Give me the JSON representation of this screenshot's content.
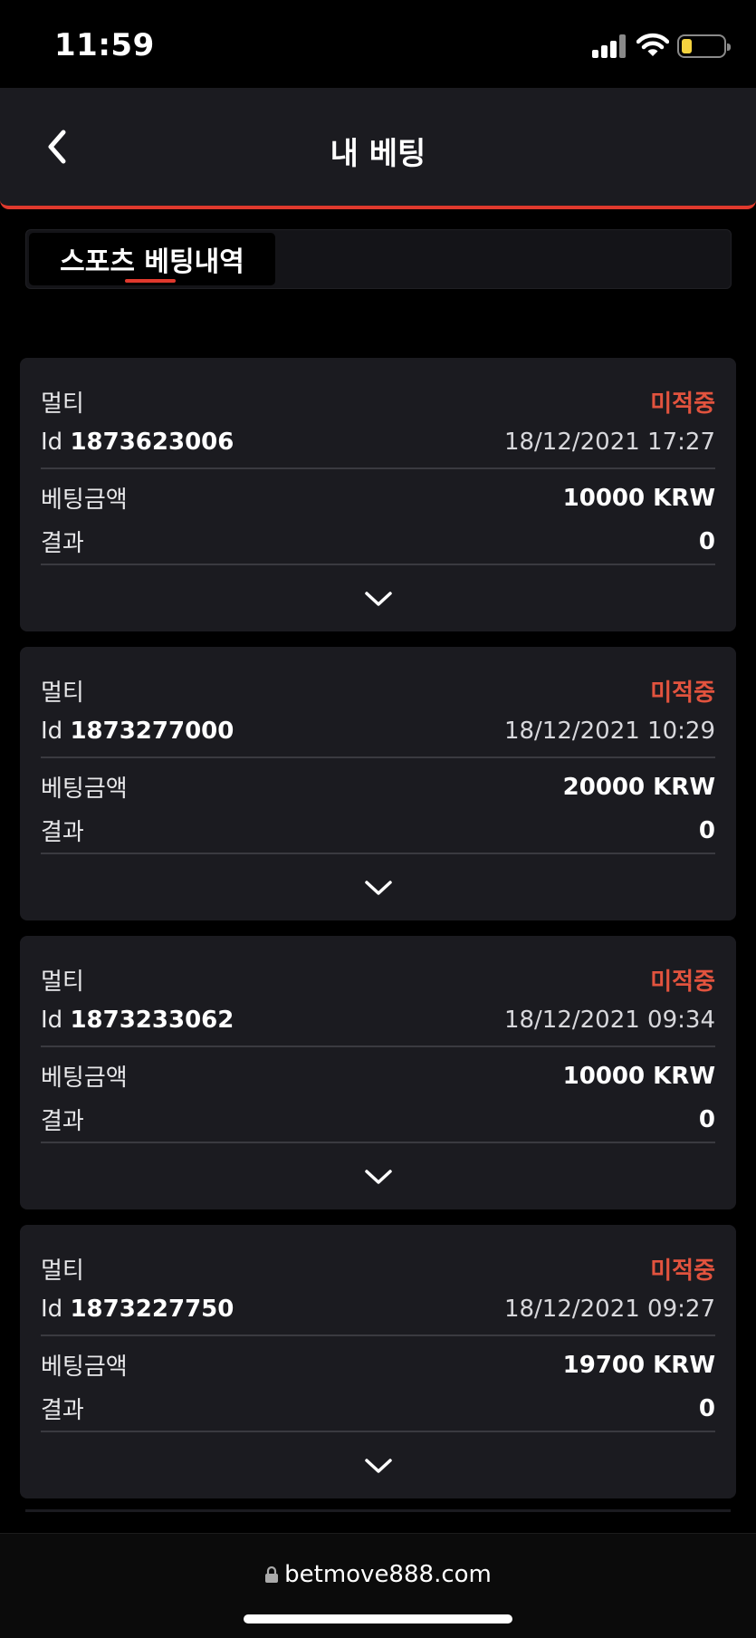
{
  "status_bar": {
    "time": "11:59"
  },
  "header": {
    "title": "내 베팅"
  },
  "tabs": [
    {
      "label": "스포츠 베팅내역",
      "active": true
    }
  ],
  "labels": {
    "amount": "베팅금액",
    "result": "결과"
  },
  "bets": [
    {
      "type": "멀티",
      "status": "미적중",
      "id_prefix": "Id",
      "id": "1873623006",
      "datetime": "18/12/2021 17:27",
      "amount": "10000 KRW",
      "result": "0"
    },
    {
      "type": "멀티",
      "status": "미적중",
      "id_prefix": "Id",
      "id": "1873277000",
      "datetime": "18/12/2021 10:29",
      "amount": "20000 KRW",
      "result": "0"
    },
    {
      "type": "멀티",
      "status": "미적중",
      "id_prefix": "Id",
      "id": "1873233062",
      "datetime": "18/12/2021 09:34",
      "amount": "10000 KRW",
      "result": "0"
    },
    {
      "type": "멀티",
      "status": "미적중",
      "id_prefix": "Id",
      "id": "1873227750",
      "datetime": "18/12/2021 09:27",
      "amount": "19700 KRW",
      "result": "0"
    }
  ],
  "browser": {
    "url": "betmove888.com"
  },
  "colors": {
    "accent": "#e0392d",
    "status_lost": "#e2533e",
    "card_bg": "#1b1b20",
    "battery": "#f5d33f"
  },
  "icons": {
    "back": "chevron-left-icon",
    "expand": "chevron-down-icon",
    "lock": "lock-icon"
  }
}
